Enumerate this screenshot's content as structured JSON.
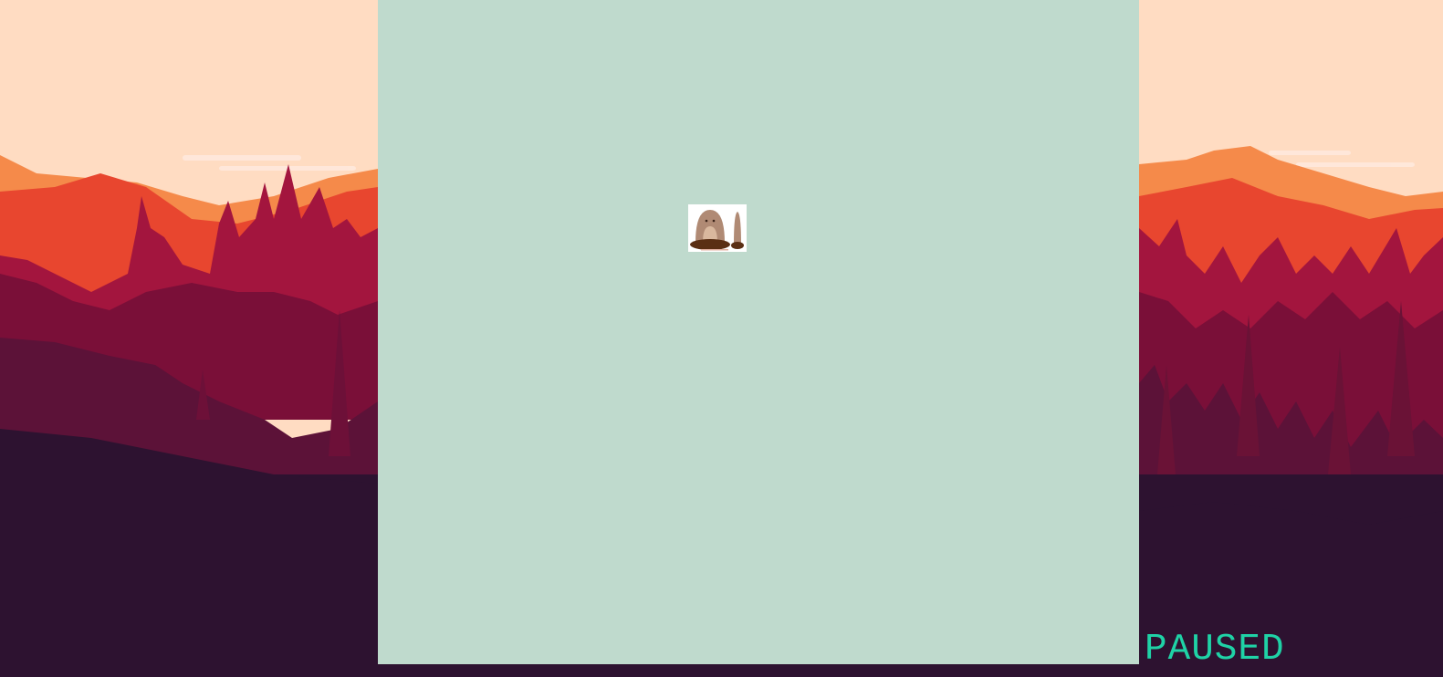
{
  "game": {
    "status_text": "PAUSED",
    "background": "sunset-forest-mountains",
    "sprite": "mole-digging-sprite"
  },
  "colors": {
    "sky": "#ffdcc2",
    "mountain_far": "#f58a4a",
    "mountain_mid": "#e8462f",
    "forest_mid": "#8a0f3a",
    "forest_dark": "#5c1238",
    "ground": "#2d1230",
    "play_area": "#bfdacd",
    "status_text": "#1fd2a6"
  }
}
